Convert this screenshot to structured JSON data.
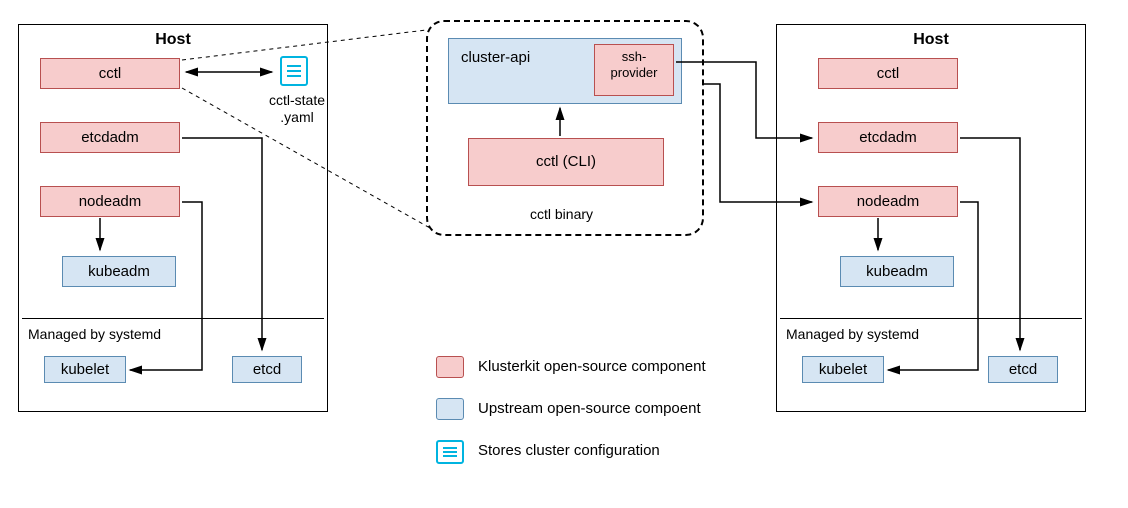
{
  "left_host": {
    "title": "Host",
    "cctl": "cctl",
    "etcdadm": "etcdadm",
    "nodeadm": "nodeadm",
    "kubeadm": "kubeadm",
    "systemd_label": "Managed by systemd",
    "kubelet": "kubelet",
    "etcd": "etcd"
  },
  "right_host": {
    "title": "Host",
    "cctl": "cctl",
    "etcdadm": "etcdadm",
    "nodeadm": "nodeadm",
    "kubeadm": "kubeadm",
    "systemd_label": "Managed by systemd",
    "kubelet": "kubelet",
    "etcd": "etcd"
  },
  "state_file": {
    "label_line1": "cctl-state",
    ".yaml": ".yaml",
    "label_full": "cctl-state\n.yaml"
  },
  "binary": {
    "cluster_api": "cluster-api",
    "ssh_provider": "ssh-\nprovider",
    "cli": "cctl (CLI)",
    "label": "cctl binary"
  },
  "legend": {
    "kluster": "Klusterkit open-source component",
    "upstream": "Upstream open-source compoent",
    "stores": "Stores cluster configuration"
  }
}
